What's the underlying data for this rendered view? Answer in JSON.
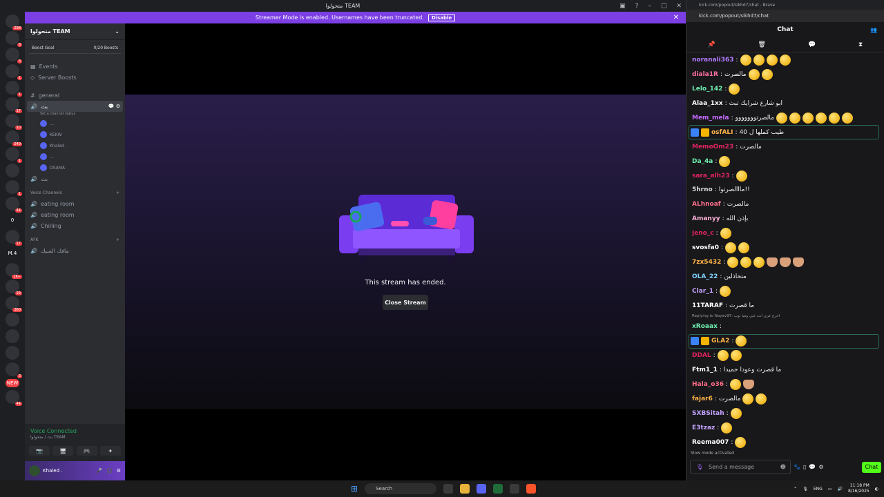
{
  "discord": {
    "window_title": "متحولوا TEAM",
    "banner": {
      "text": "Streamer Mode is enabled. Usernames have been truncated.",
      "disable_label": "Disable"
    },
    "servers": [
      {
        "badge": "298"
      },
      {
        "badge": "8"
      },
      {
        "badge": "3"
      },
      {
        "badge": "1"
      },
      {
        "badge": "1"
      },
      {
        "badge": "17"
      },
      {
        "badge": "10"
      },
      {
        "badge": "249"
      },
      {
        "badge": "1"
      },
      {
        "badge": ""
      },
      {
        "badge": "1"
      },
      {
        "badge": "44"
      },
      {
        "badge": ""
      },
      {
        "badge": "17"
      },
      {
        "badge": ""
      },
      {
        "badge": "1K+"
      },
      {
        "badge": "29"
      },
      {
        "badge": "360"
      },
      {
        "badge": ""
      },
      {
        "badge": ""
      },
      {
        "badge": ""
      },
      {
        "badge": "3"
      },
      {
        "badge": ""
      },
      {
        "badge": "44"
      }
    ],
    "server_labels": {
      "zero": "0",
      "m4": "M.4",
      "new": "NEW"
    },
    "guild_name": "متحولوا TEAM",
    "boost_goal": {
      "label": "Boost Goal",
      "progress": "0/20 Boosts"
    },
    "events_label": "Events",
    "server_boosts_label": "Server Boosts",
    "general_label": "general",
    "active_voice": {
      "name": "بث",
      "status": "Set a channel status"
    },
    "voice_users": [
      "...",
      "KEKW",
      "Khaled .",
      "...",
      "OSAMA"
    ],
    "second_voice": "بث",
    "voice_category": "Voice Channels",
    "voice_channels": [
      "eating room",
      "eating room",
      "Chilling"
    ],
    "afk_category": "AFK",
    "afk_channel": "مافك السيك",
    "voice_connected": "Voice Connected",
    "voice_location": "بث / متحولوا TEAM",
    "user_name": "Khaled .",
    "stream_ended": "This stream has ended.",
    "close_stream": "Close Stream"
  },
  "browser": {
    "title": "kick.com/popout/sikhd7/chat - Brave",
    "url": "kick.com/popout/sikhd7/chat"
  },
  "chat": {
    "header": "Chat",
    "messages": [
      {
        "user": "noranali363",
        "color": "#b57bff",
        "text": "",
        "emotes": 4
      },
      {
        "user": "diala1R",
        "color": "#ff6fa0",
        "text": "مالصرت",
        "emotes": 2
      },
      {
        "user": "Lelo_142",
        "color": "#6ef0b0",
        "text": "",
        "emotes": 1
      },
      {
        "user": "Alaa_1xx",
        "color": "#ffffff",
        "text": "ابو شارع شرايك تبث",
        "emotes": 0
      },
      {
        "user": "Mem_mela",
        "color": "#c46bff",
        "text": "مالصرتووووووو",
        "emotes": 6
      },
      {
        "user": "osfALI",
        "color": "#ffb347",
        "text": "طيب كملها ل 40",
        "emotes": 0,
        "highlight": true
      },
      {
        "user": "MemoOm23",
        "color": "#e0245e",
        "text": "مالصرت",
        "emotes": 0
      },
      {
        "user": "Da_4a",
        "color": "#6ef0b0",
        "text": "",
        "emotes": 1
      },
      {
        "user": "sara_alh23",
        "color": "#e0245e",
        "text": "",
        "emotes": 1
      },
      {
        "user": "5hrno",
        "color": "#dddddd",
        "text": "مااالصرتوا!!",
        "emotes": 0
      },
      {
        "user": "ALhnoaf",
        "color": "#ff6f8a",
        "text": "مالصرت",
        "emotes": 0
      },
      {
        "user": "Amanyy",
        "color": "#ffb3d9",
        "text": "بإذن الله",
        "emotes": 0
      },
      {
        "user": "jeno_c",
        "color": "#e0245e",
        "text": "",
        "emotes": 1
      },
      {
        "user": "svosfa0",
        "color": "#ffffff",
        "text": "",
        "emotes": 2
      },
      {
        "user": "7zx5432",
        "color": "#ffb347",
        "text": "",
        "emotes": 3,
        "hearts": 3
      },
      {
        "user": "OLA_22",
        "color": "#7fd4ff",
        "text": "متخاذلين",
        "emotes": 0
      },
      {
        "user": "Clar_1",
        "color": "#c5a3ff",
        "text": "",
        "emotes": 1
      },
      {
        "user": "11TARAF",
        "color": "#ffffff",
        "text": "ما قصرت",
        "emotes": 0
      },
      {
        "user": "xRoaax",
        "color": "#6ef0b0",
        "text": "",
        "emotes": 0,
        "reply": "Replying to Nayav97: اخرج غزي انت غبي ومبا نوب"
      },
      {
        "user": "GLA2",
        "color": "#ffb347",
        "text": "",
        "emotes": 1,
        "highlight": true
      },
      {
        "user": "DDAL",
        "color": "#e0245e",
        "text": "",
        "emotes": 2
      },
      {
        "user": "Ftm1_1",
        "color": "#ffffff",
        "text": "ما قصرت وعودا حميدا",
        "emotes": 0
      },
      {
        "user": "Hala_o36",
        "color": "#ff6f8a",
        "text": "",
        "emotes": 1,
        "hearts": 1
      },
      {
        "user": "fajar6",
        "color": "#ffb347",
        "text": "مالصرت",
        "emotes": 2
      },
      {
        "user": "SXBSitah",
        "color": "#c5a3ff",
        "text": "",
        "emotes": 1
      },
      {
        "user": "E3tzaz",
        "color": "#c5a3ff",
        "text": "",
        "emotes": 1
      },
      {
        "user": "Reema007",
        "color": "#ffffff",
        "text": "",
        "emotes": 1
      }
    ],
    "slow_mode": "Slow mode activated",
    "input_placeholder": "Send a message",
    "send_label": "Chat"
  },
  "taskbar": {
    "search_placeholder": "Search",
    "lang": "ENG",
    "time": "11:18 PM",
    "date": "8/16/2025"
  }
}
